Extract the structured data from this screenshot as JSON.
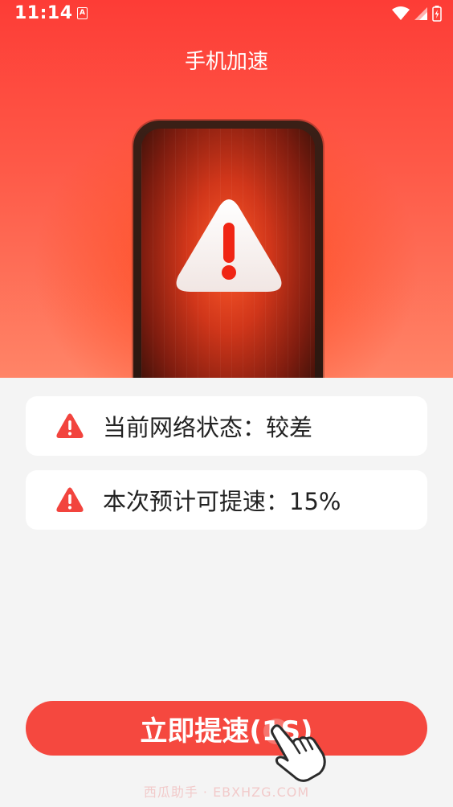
{
  "status_bar": {
    "time": "11:14",
    "app_icon_letter": "A",
    "icons": [
      "notification-app-icon",
      "wifi-icon",
      "signal-icon",
      "battery-icon"
    ]
  },
  "header": {
    "title": "手机加速"
  },
  "illustration": {
    "icon": "warning-triangle-icon",
    "accent_color": "#ff4a1c"
  },
  "cards": [
    {
      "icon": "warning-icon",
      "text": "当前网络状态：较差"
    },
    {
      "icon": "warning-icon",
      "text": "本次预计可提速：15%"
    }
  ],
  "action": {
    "label": "立即提速(1S)",
    "color": "#f5483f",
    "icon": "pointing-hand-icon"
  },
  "watermark": "西瓜助手 · EBXHZG.COM",
  "colors": {
    "primary": "#fd3c36",
    "background": "#f4f4f4",
    "warning": "#f2443e"
  }
}
